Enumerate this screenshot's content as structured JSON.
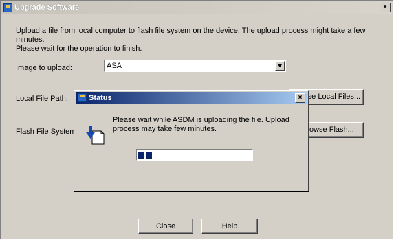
{
  "window": {
    "title": "Upgrade Software",
    "close": "×"
  },
  "intro": "Upload a file from local computer to flash file system on the device. The upload process might take a few minutes.\nPlease wait for the operation to finish.",
  "form": {
    "image_label": "Image to upload:",
    "image_value": "ASA",
    "local_path_label": "Local File Path:",
    "browse_local": "rse Local Files...",
    "flash_path_label": "Flash File System Pa",
    "browse_flash": "owse Flash..."
  },
  "footer": {
    "close": "Close",
    "help": "Help"
  },
  "status_dialog": {
    "title": "Status",
    "close": "×",
    "message": "Please wait while ASDM is uploading the file. Upload process may take few minutes.",
    "progress": 0.12
  },
  "colors": {
    "title_active": "#0a246a",
    "dialog_bg": "#d4d0c8"
  }
}
